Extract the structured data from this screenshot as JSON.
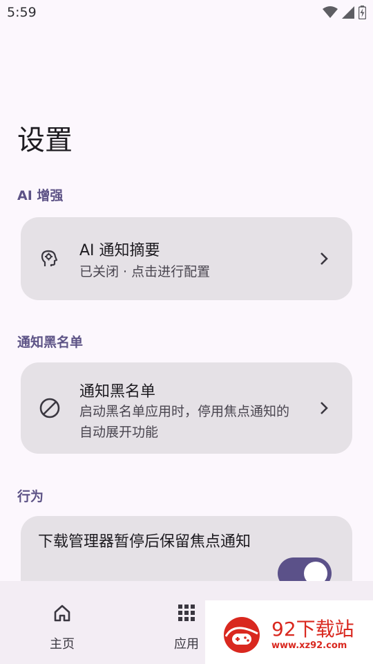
{
  "status_bar": {
    "time": "5:59",
    "icons": [
      "wifi-icon",
      "signal-icon",
      "battery-icon"
    ]
  },
  "page": {
    "title": "设置"
  },
  "sections": {
    "ai": {
      "header": "AI 增强",
      "card": {
        "title": "AI 通知摘要",
        "subtitle": "已关闭 · 点击进行配置",
        "icon": "ai-brain-icon"
      }
    },
    "blacklist": {
      "header": "通知黑名单",
      "card": {
        "title": "通知黑名单",
        "subtitle": "启动黑名单应用时，停用焦点通知的自动展开功能",
        "icon": "block-icon"
      }
    },
    "behavior": {
      "header": "行为",
      "toggle": {
        "title": "下载管理器暂停后保留焦点通知",
        "enabled": true
      }
    }
  },
  "bottom_nav": {
    "items": [
      {
        "label": "主页",
        "icon": "home-icon"
      },
      {
        "label": "应用",
        "icon": "apps-grid-icon"
      }
    ]
  },
  "watermark": {
    "main": "92下载站",
    "sub": "www.xz92.com"
  },
  "colors": {
    "background": "#FCF7FD",
    "card": "#E5E1E6",
    "accent": "#5B5189",
    "section_header": "#5D5386",
    "watermark": "#D9281F"
  }
}
